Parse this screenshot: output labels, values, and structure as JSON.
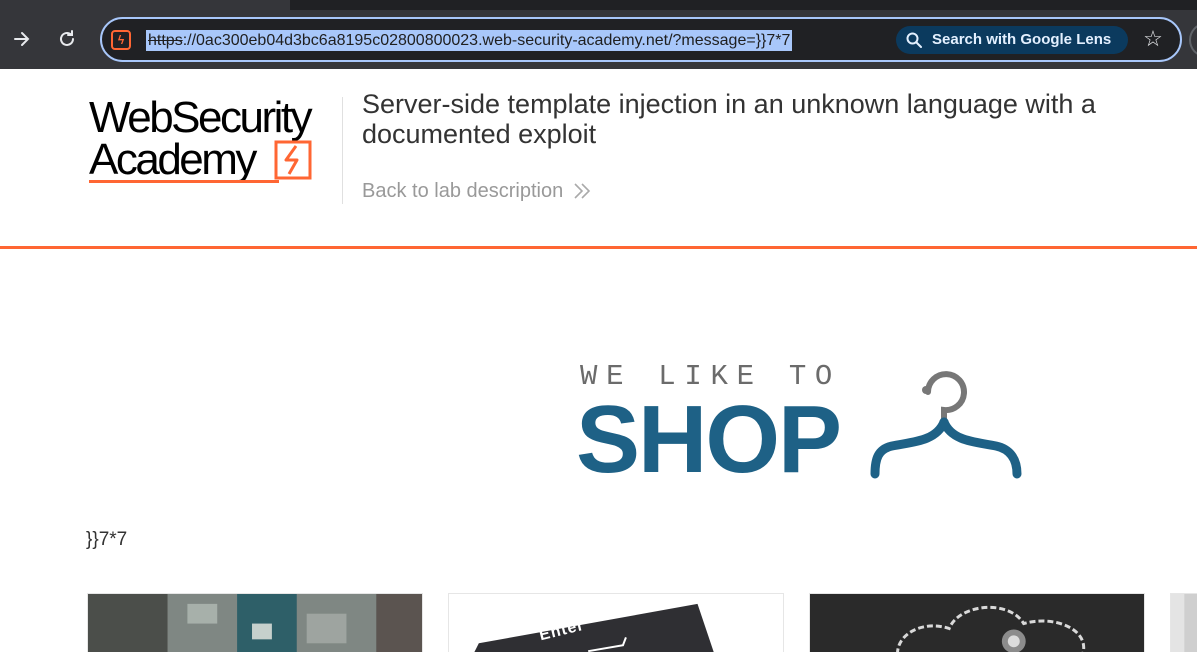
{
  "browser": {
    "url_scheme": "https",
    "url_rest": "://0ac300eb04d3bc6a8195c02800800023.web-security-academy.net/?message=}}7*7",
    "lens_label": "Search with Google Lens",
    "icons": {
      "forward": "arrow-right-icon",
      "reload": "reload-icon",
      "site": "site-info-icon",
      "lens": "search-icon",
      "bookmark": "star-icon"
    }
  },
  "lab_header": {
    "logo_line1": "WebSecurity",
    "logo_line2": "Academy",
    "title": "Server-side template injection in an unknown language with a documented exploit",
    "back_link": "Back to lab description",
    "accent_color": "#ff6633"
  },
  "shop_banner": {
    "tagline": "WE LIKE TO",
    "word": "SHOP",
    "brand_color": "#1e6186"
  },
  "message": "}}7*7",
  "product_cards": [
    {
      "image": "city-aerial-photo"
    },
    {
      "image": "enter-key-photo",
      "key_label": "Enter"
    },
    {
      "image": "chalk-cloud-lightbulb-photo"
    },
    {
      "image": "partial-photo"
    }
  ]
}
